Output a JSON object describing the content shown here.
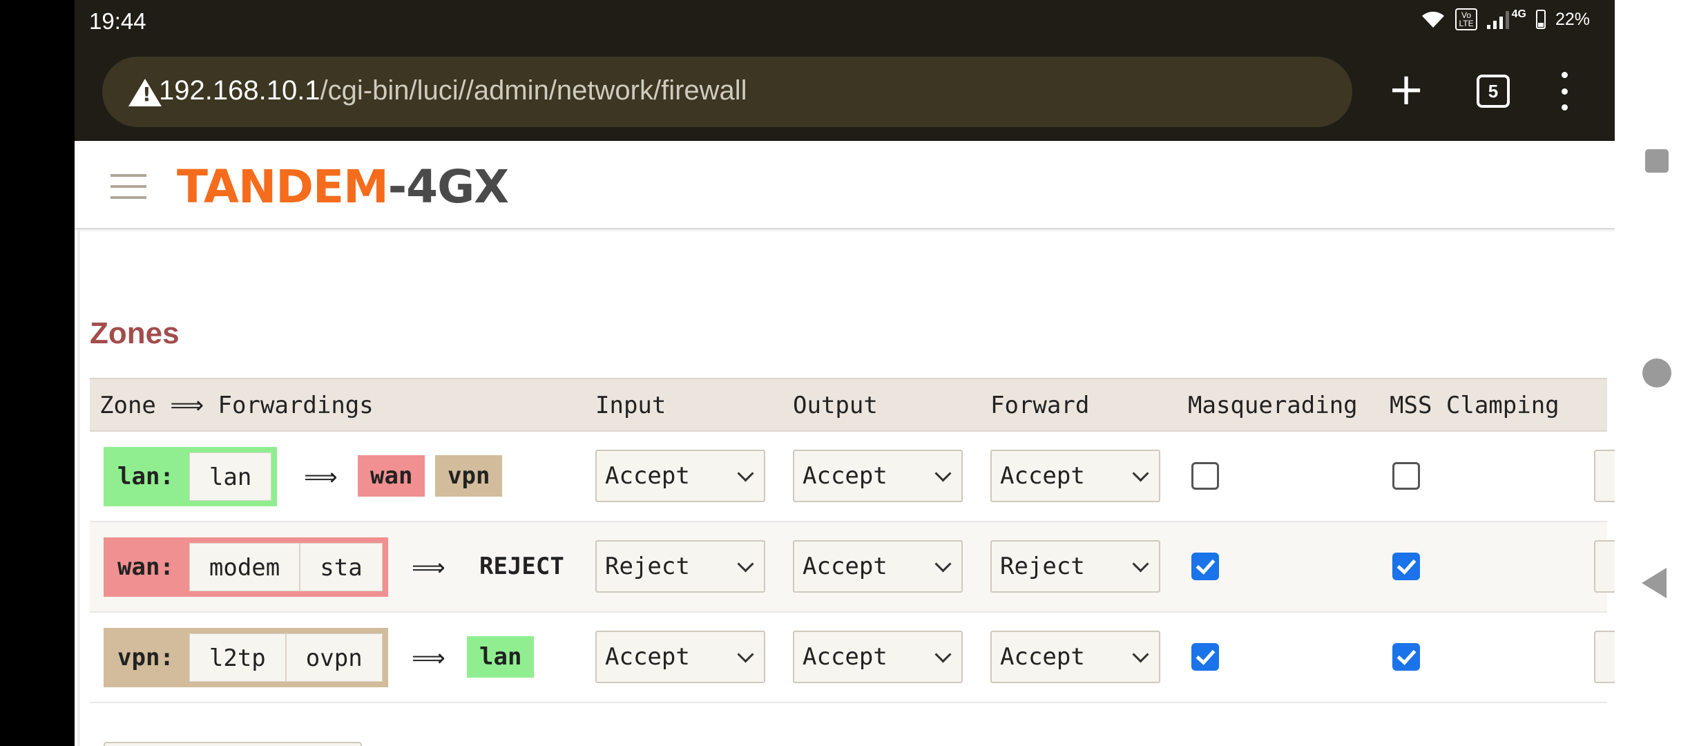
{
  "status_bar": {
    "time": "19:44",
    "volte": "Vo LTE",
    "network": "4G",
    "battery": "22%"
  },
  "browser": {
    "url_host": "192.168.10.1",
    "url_path": "/cgi-bin/luci//admin/network/firewall",
    "new_tab_label": "+",
    "tab_count": "5"
  },
  "header": {
    "logo_part1": "TANDEM",
    "logo_part2": "-4GX"
  },
  "zones": {
    "title": "Zones",
    "headers": {
      "zone": "Zone ⟹ Forwardings",
      "input": "Input",
      "output": "Output",
      "forward": "Forward",
      "masq": "Masquerading",
      "mss": "MSS Clamping"
    },
    "rows": [
      {
        "zone": "lan:",
        "networks": [
          "lan"
        ],
        "arrow": "⟹",
        "forwards": [
          "wan",
          "vpn"
        ],
        "input": "Accept",
        "output": "Accept",
        "forward": "Accept",
        "masquerading": false,
        "mss_clamping": false
      },
      {
        "zone": "wan:",
        "networks": [
          "modem",
          "sta"
        ],
        "arrow": "⟹",
        "forward_text": "REJECT",
        "input": "Reject",
        "output": "Accept",
        "forward": "Reject",
        "masquerading": true,
        "mss_clamping": true
      },
      {
        "zone": "vpn:",
        "networks": [
          "l2tp",
          "ovpn"
        ],
        "arrow": "⟹",
        "forwards": [
          "lan"
        ],
        "input": "Accept",
        "output": "Accept",
        "forward": "Accept",
        "masquerading": true,
        "mss_clamping": true
      }
    ]
  },
  "colors": {
    "lan": "#90ee90",
    "wan": "#f09090",
    "vpn": "#d2bc9c",
    "title": "#a34d4d",
    "logo_orange": "#f46c1c",
    "checkbox_blue": "#1a73e8"
  },
  "icons": [
    "warning-icon",
    "plus-icon",
    "tab-switcher-icon",
    "kebab-menu-icon",
    "hamburger-icon",
    "wifi-icon",
    "signal-icon",
    "battery-icon",
    "chevron-down-icon"
  ]
}
